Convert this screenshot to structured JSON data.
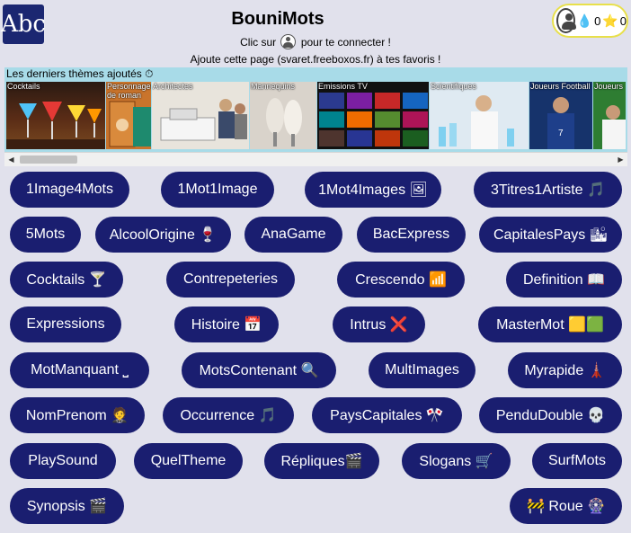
{
  "header": {
    "logo": "Abc",
    "title": "BouniMots",
    "login_prefix": "Clic sur",
    "login_suffix": "pour te connecter !",
    "favorites_text": "Ajoute cette page (svaret.freeboxos.fr) à tes favoris !"
  },
  "score": {
    "drops": "0",
    "stars": "0"
  },
  "themes": {
    "heading": "Les derniers thèmes ajoutés ⏱",
    "items": [
      "Cocktails",
      "Personnages de roman",
      "Architectes",
      "Mannequins",
      "Emissions TV",
      "Scientifiques",
      "Joueurs Football",
      "Joueurs"
    ]
  },
  "games": [
    "1Image4Mots",
    "1Mot1Image",
    "1Mot4Images 🖼",
    "3Titres1Artiste 🎵",
    "5Mots",
    "AlcoolOrigine 🍷",
    "AnaGame",
    "BacExpress",
    "CapitalesPays 🏙",
    "Cocktails 🍸",
    "Contrepeteries",
    "Crescendo 📶",
    "Definition 📖",
    "Expressions",
    "Histoire 📅",
    "Intrus ❌",
    "MasterMot 🟨🟩",
    "MotManquant ⎵",
    "MotsContenant 🔍",
    "MultImages",
    "Myrapide 🗼",
    "NomPrenom 🤵",
    "Occurrence 🎵",
    "PaysCapitales 🎌",
    "PenduDouble 💀",
    "PlaySound",
    "QuelTheme",
    "Répliques🎬",
    "Slogans 🛒",
    "SurfMots",
    "Synopsis 🎬",
    "🚧 Roue 🎡"
  ]
}
